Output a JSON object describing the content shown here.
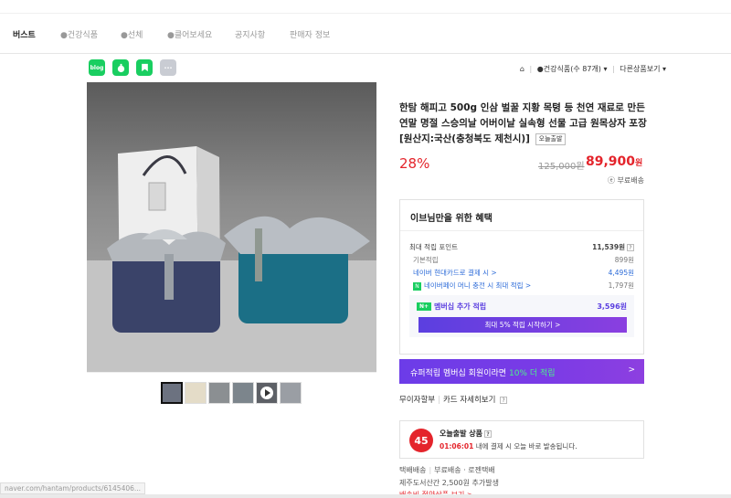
{
  "nav": {
    "items": [
      "버스트",
      "●건강식품",
      "●선체",
      "●클어보세요",
      "공지사항",
      "판매자 정보"
    ]
  },
  "share": {
    "buttons": [
      {
        "label": "blog",
        "icon": "blog-share-icon"
      },
      {
        "label": "",
        "icon": "cafe-share-icon"
      },
      {
        "label": "",
        "icon": "bookmark-share-icon"
      },
      {
        "label": "···",
        "icon": "more-icon"
      }
    ]
  },
  "breadcrumb": {
    "home_icon": "home-icon",
    "category": "●건강식품(수 87개)",
    "other": "다른상품보기"
  },
  "product": {
    "title": "한탐 해피고 500g 인삼 벌꿀 지황 목텽 등 천연 재료로 만든 연말 명절 스승의날 어버이날 실속형 선물 고급 원목상자 포장 [원산지:국산(충청북도 제천시)]",
    "title_badge": "오늘출발",
    "discount": "28%",
    "original_price": "125,000원",
    "sale_price": "89,900",
    "sale_unit": "원",
    "shipping": "ⓔ 부료배송"
  },
  "benefits": {
    "heading": "이브님만을 위한 혜택",
    "max_point_label": "최대 적립 포인트",
    "max_point_value": "11,539원",
    "base_label": "기본적립",
    "base_value": "899원",
    "card_label": "네이버 현대카드로 결제 시 >",
    "card_value": "4,495원",
    "pay_label": "네이버페이 머니 충전 시 최대 적립 >",
    "pay_value": "1,797원",
    "member_label": "멤버십 추가 적립",
    "member_value": "3,596원",
    "member_button": "최대 5% 적립 시작하기 >"
  },
  "promo": {
    "lead": "슈퍼적립 멤버십 회원이라면",
    "highlight": "10% 더 적립",
    "arrow": ">"
  },
  "inquiry": {
    "label": "무이자할부",
    "link": "카드 자세히보기"
  },
  "today": {
    "logo": "45",
    "title": "오늘출발 상품",
    "time": "01:06:01",
    "message": "내에 결제 시 오늘 바로 발송됩니다."
  },
  "shipping_info": {
    "line1_a": "택배배송",
    "line1_b": "부료배송 · 로젠택배",
    "line2": "제주도서산간 2,500원 추가발생",
    "line3": "배송비 절약상품 보기 >"
  },
  "statusbar": {
    "url": "naver.com/hantam/products/6145406..."
  },
  "colors": {
    "accent_red": "#e4242b",
    "naver_green": "#19ce60",
    "membership_purple": "#6c3ce8"
  }
}
